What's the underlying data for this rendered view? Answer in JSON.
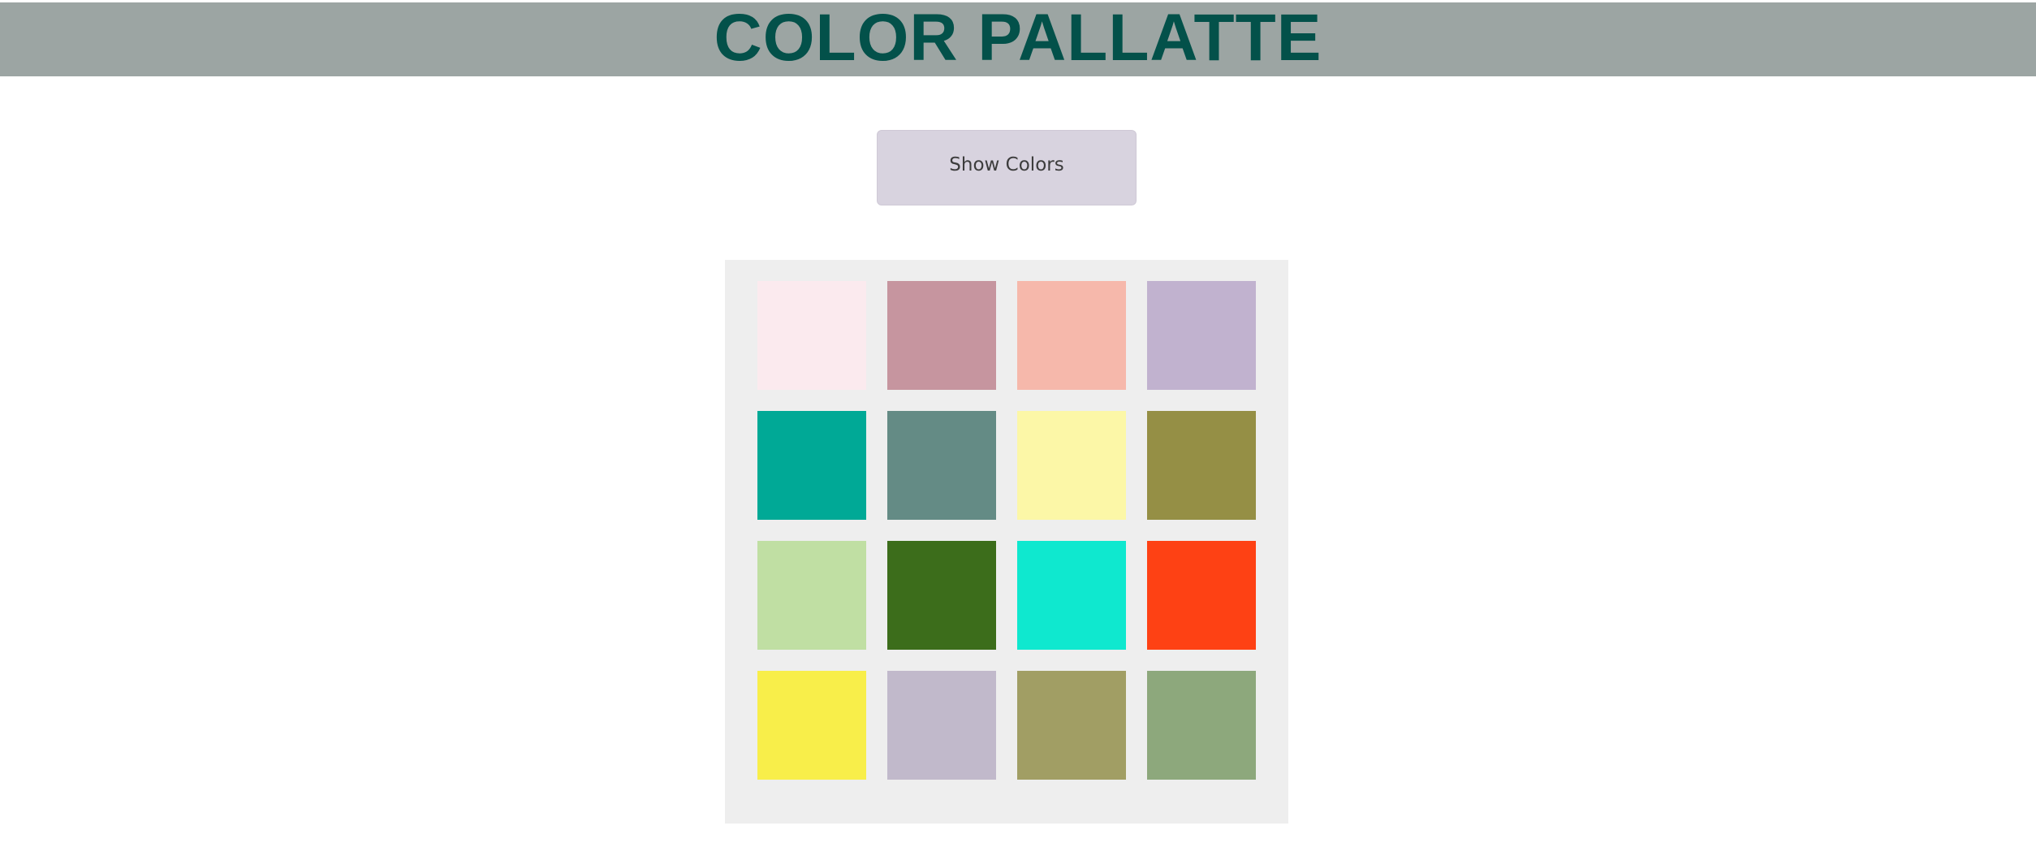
{
  "header": {
    "title": "COLOR PALLATTE",
    "background": "#9ca5a3",
    "title_color": "#03514a"
  },
  "show_button": {
    "label": "Show Colors"
  },
  "palette": {
    "background": "#eeeeee",
    "swatches": [
      "#fbeaee",
      "#c6959f",
      "#f6b8ab",
      "#c1b2cf",
      "#00a996",
      "#648b85",
      "#fcf7a7",
      "#958f45",
      "#c0dfa3",
      "#3c6d1b",
      "#0fe8cf",
      "#fe4114",
      "#f8ee4a",
      "#c1b9cb",
      "#a19e64",
      "#8da87c"
    ]
  }
}
